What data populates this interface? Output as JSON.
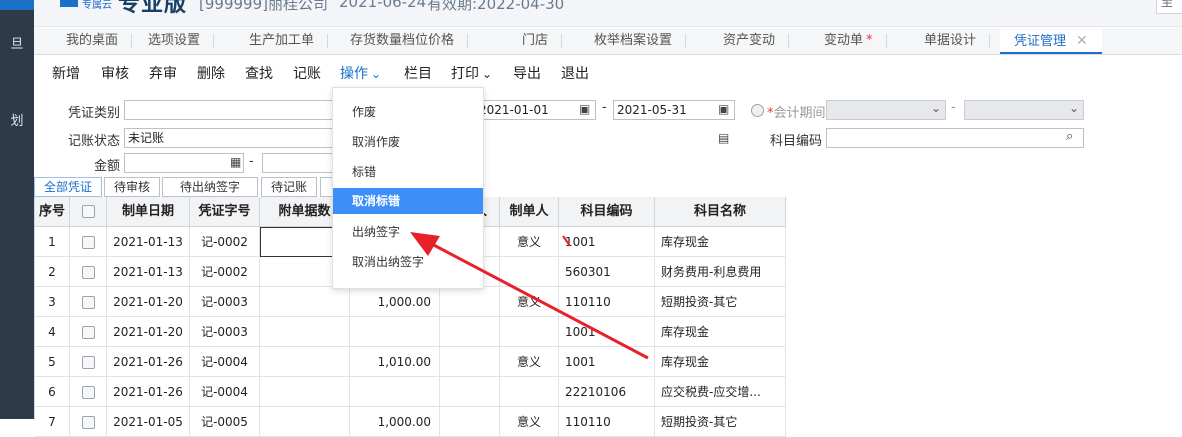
{
  "header": {
    "brand_small": "专属云",
    "brand_big": "专业版",
    "company": "[999999]丽桂公司",
    "date": "2021-06-24",
    "valid": "有效期:2022-04-30",
    "corner": "至"
  },
  "rail": {
    "glyph1": "旦",
    "glyph2": "划"
  },
  "tabs": [
    {
      "label": "我的桌面"
    },
    {
      "label": "选项设置"
    },
    {
      "label": "生产加工单"
    },
    {
      "label": "存货数量档位价格"
    },
    {
      "label": "门店"
    },
    {
      "label": "枚举档案设置"
    },
    {
      "label": "资产变动"
    },
    {
      "label": "变动单",
      "star": "*"
    },
    {
      "label": "单据设计"
    },
    {
      "label": "凭证管理",
      "close": "✕"
    }
  ],
  "toolbar": {
    "items": [
      "新增",
      "审核",
      "弃审",
      "删除",
      "查找",
      "记账",
      "操作",
      "栏目",
      "打印",
      "导出",
      "退出"
    ],
    "caret": "⌄"
  },
  "filters": {
    "voucher_type_label": "凭证类别",
    "voucher_type_value": "",
    "status_label": "记账状态",
    "status_value": "未记账",
    "amount_label": "金额",
    "amount_from": "",
    "amount_to": "",
    "dash": "-",
    "date_from": "2021-01-01",
    "date_to": "2021-05-31",
    "period_label": "会计期间",
    "period_required": "*",
    "period_from": "",
    "period_to": "",
    "account_code_label": "科目编码",
    "account_code_value": ""
  },
  "status_tabs": [
    "全部凭证",
    "待审核",
    "待出纳签字",
    "待记账",
    ""
  ],
  "table": {
    "headers": [
      "序号",
      "",
      "制单日期",
      "凭证字号",
      "附单据数",
      "",
      "人",
      "制单人",
      "科目编码",
      "科目名称"
    ],
    "rows": [
      {
        "no": "1",
        "date": "2021-01-13",
        "voucher": "记-0002",
        "amount": "",
        "maker": "意义",
        "code": "1001",
        "name": "库存现金"
      },
      {
        "no": "2",
        "date": "2021-01-13",
        "voucher": "记-0002",
        "amount": "",
        "maker": "",
        "code": "560301",
        "name": "财务费用-利息费用"
      },
      {
        "no": "3",
        "date": "2021-01-20",
        "voucher": "记-0003",
        "amount": "1,000.00",
        "maker": "意义",
        "code": "110110",
        "name": "短期投资-其它"
      },
      {
        "no": "4",
        "date": "2021-01-20",
        "voucher": "记-0003",
        "amount": "",
        "maker": "",
        "code": "1001",
        "name": "库存现金"
      },
      {
        "no": "5",
        "date": "2021-01-26",
        "voucher": "记-0004",
        "amount": "1,010.00",
        "maker": "意义",
        "code": "1001",
        "name": "库存现金"
      },
      {
        "no": "6",
        "date": "2021-01-26",
        "voucher": "记-0004",
        "amount": "",
        "maker": "",
        "code": "22210106",
        "name": "应交税费-应交增..."
      },
      {
        "no": "7",
        "date": "2021-01-05",
        "voucher": "记-0005",
        "amount": "1,000.00",
        "maker": "意义",
        "code": "110110",
        "name": "短期投资-其它"
      }
    ]
  },
  "dropdown": {
    "items": [
      "作废",
      "取消作废",
      "标错",
      "取消标错",
      "出纳签字",
      "取消出纳签字"
    ],
    "highlighted_index": 3
  },
  "colors": {
    "accent": "#1a6fc9",
    "highlight": "#3d8ff7",
    "annotation": "#e8202a"
  }
}
